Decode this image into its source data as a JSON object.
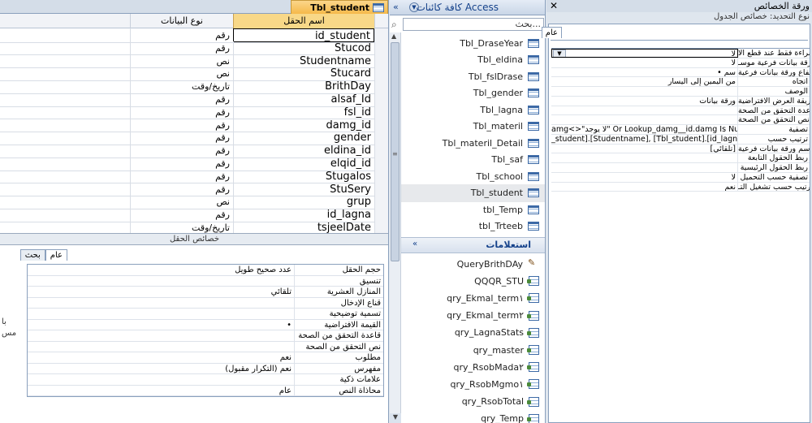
{
  "design_view": {
    "tab_title": "Tbl_student",
    "col_field_name": "اسم الحقل",
    "col_data_type": "نوع البيانات",
    "fields": [
      {
        "name": "id_student",
        "type": "رقم"
      },
      {
        "name": "Stucod",
        "type": "رقم"
      },
      {
        "name": "Studentname",
        "type": "نص"
      },
      {
        "name": "Stucard",
        "type": "نص"
      },
      {
        "name": "BrithDay",
        "type": "تاريخ/وقت"
      },
      {
        "name": "alsaf_Id",
        "type": "رقم"
      },
      {
        "name": "fsl_id",
        "type": "رقم"
      },
      {
        "name": "damg_id",
        "type": "رقم"
      },
      {
        "name": "gender",
        "type": "رقم"
      },
      {
        "name": "eldina_id",
        "type": "رقم"
      },
      {
        "name": "elqid_id",
        "type": "رقم"
      },
      {
        "name": "Stugalos",
        "type": "رقم"
      },
      {
        "name": "StuSery",
        "type": "رقم"
      },
      {
        "name": "grup",
        "type": "نص"
      },
      {
        "name": "id_lagna",
        "type": "رقم"
      },
      {
        "name": "tsjeelDate",
        "type": "تاريخ/وقت"
      }
    ],
    "field_properties_label": "خصائص الحقل",
    "tabs": {
      "general": "عام",
      "lookup": "بحث"
    },
    "properties": [
      {
        "label": "حجم الحقل",
        "value": "عدد صحيح طويل"
      },
      {
        "label": "تنسيق",
        "value": ""
      },
      {
        "label": "المنازل العشرية",
        "value": "تلقائي"
      },
      {
        "label": "قناع الإدخال",
        "value": ""
      },
      {
        "label": "تسمية توضيحية",
        "value": ""
      },
      {
        "label": "القيمة الافتراضية",
        "value": "•"
      },
      {
        "label": "قاعدة التحقق من الصحة",
        "value": ""
      },
      {
        "label": "نص التحقق من الصحة",
        "value": ""
      },
      {
        "label": "مطلوب",
        "value": "نعم"
      },
      {
        "label": "مفهرس",
        "value": "نعم (التكرار مقبول)"
      },
      {
        "label": "علامات ذكية",
        "value": ""
      },
      {
        "label": "محاذاة النص",
        "value": "عام"
      }
    ],
    "help_text": "با\nمس"
  },
  "nav": {
    "title": "كافة كائنات Access",
    "collapse_glyph": "«",
    "dropdown_glyph": "▼",
    "search_placeholder": "بحث...",
    "search_glyph": "⌕",
    "tables": [
      {
        "label": "Tbl_DraseYear",
        "selected": false
      },
      {
        "label": "Tbl_eldina",
        "selected": false
      },
      {
        "label": "Tbl_fslDrase",
        "selected": false
      },
      {
        "label": "Tbl_gender",
        "selected": false
      },
      {
        "label": "Tbl_lagna",
        "selected": false
      },
      {
        "label": "Tbl_materil",
        "selected": false
      },
      {
        "label": "Tbl_materil_Detail",
        "selected": false
      },
      {
        "label": "Tbl_saf",
        "selected": false
      },
      {
        "label": "Tbl_school",
        "selected": false
      },
      {
        "label": "Tbl_student",
        "selected": true
      },
      {
        "label": "tbl_Temp",
        "selected": false
      },
      {
        "label": "tbl_Trteeb",
        "selected": false
      }
    ],
    "queries_header": "استعلامات",
    "queries_collapse_glyph": "«",
    "queries": [
      {
        "label": "QueryBrithDAy",
        "kind": "design"
      },
      {
        "label": "QQQR_STU",
        "kind": "select"
      },
      {
        "label": "qry_Ekmal_term١",
        "kind": "select"
      },
      {
        "label": "qry_Ekmal_term٢",
        "kind": "select"
      },
      {
        "label": "qry_LagnaStats",
        "kind": "select"
      },
      {
        "label": "qry_master",
        "kind": "select"
      },
      {
        "label": "qry_RsobMada٢",
        "kind": "select"
      },
      {
        "label": "qry_RsobMgmo١",
        "kind": "select"
      },
      {
        "label": "qry_RsobTotal",
        "kind": "select"
      },
      {
        "label": "qry_Temp",
        "kind": "select"
      }
    ]
  },
  "property_sheet": {
    "title": "ورقة الخصائص",
    "close_glyph": "✕",
    "selection_type": "نوع التحديد: خصائص الجدول",
    "tab_general": "عام",
    "dropdown_glyph": "▼",
    "rows": [
      {
        "label": "للقراءة فقط عند قطع الا",
        "value": "لا"
      },
      {
        "label": "ورقة بيانات فرعية موسـ",
        "value": "لا"
      },
      {
        "label": "ارتفاع ورقة بيانات فرعية",
        "value": "• سم"
      },
      {
        "label": "اتجاه",
        "value": "من اليمين إلى اليسار"
      },
      {
        "label": "الوصف",
        "value": ""
      },
      {
        "label": "طريقة العرض الافتراضية",
        "value": "ورقة بيانات"
      },
      {
        "label": "قاعدة التحقق من الصحة",
        "value": ""
      },
      {
        "label": "نص التحقق من الصحة",
        "value": ""
      },
      {
        "label": "تصفية",
        "value": "amg<>\"لا يوجد\" Or Lookup_damg__id.damg Is Null)"
      },
      {
        "label": "ترتيب حسب",
        "value": "_student].[Studentname], [Tbl_student].[id_lagna]"
      },
      {
        "label": "اسم ورقة بيانات فرعية",
        "value": "[تلقائي]"
      },
      {
        "label": "ربط الحقول التابعة",
        "value": ""
      },
      {
        "label": "ربط الحقول الرئيسية",
        "value": ""
      },
      {
        "label": "تصفية حسب التحميل",
        "value": "لا"
      },
      {
        "label": "ترتيب حسب تشغيل التـ",
        "value": "نعم"
      }
    ]
  }
}
